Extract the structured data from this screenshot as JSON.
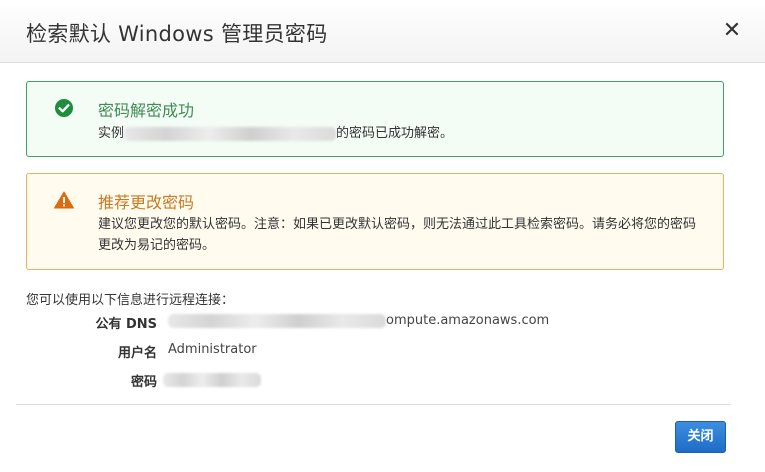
{
  "dialog": {
    "title": "检索默认 Windows 管理员密码",
    "close_glyph": "✕"
  },
  "success_alert": {
    "title": "密码解密成功",
    "body_prefix": "实例",
    "body_suffix": "的密码已成功解密。",
    "icon": "check-circle-icon",
    "color": "#1e8e3e"
  },
  "warning_alert": {
    "title": "推荐更改密码",
    "body": "建议您更改您的默认密码。注意：如果已更改默认密码，则无法通过此工具检索密码。请务必将您的密码更改为易记的密码。",
    "icon": "warning-triangle-icon",
    "color": "#dd6b10"
  },
  "connection": {
    "intro": "您可以使用以下信息进行远程连接：",
    "dns_label": "公有 DNS",
    "dns_value_visible": "ompute.amazonaws.com",
    "user_label": "用户名",
    "user_value": "Administrator",
    "password_label": "密码"
  },
  "footer": {
    "close_button": "关闭"
  }
}
